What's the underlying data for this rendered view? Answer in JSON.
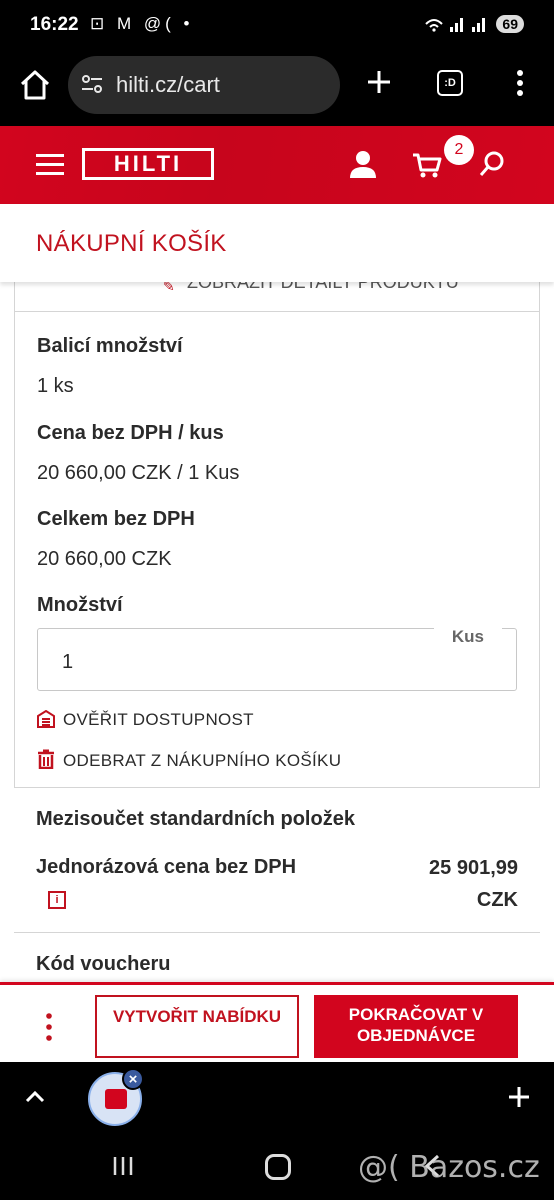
{
  "status_bar": {
    "time": "16:22",
    "left_icons": "⊡ M @(  •",
    "right_icons": "wifi ▂▄▆ ▂▄▆",
    "battery": "69"
  },
  "browser": {
    "url": "hilti.cz/cart",
    "tabs_label": ":D"
  },
  "header": {
    "logo_text": "HILTI",
    "cart_count": "2",
    "brand_color": "#d2051e"
  },
  "page": {
    "title": "NÁKUPNÍ KOŠÍK"
  },
  "product": {
    "details_link": "ZOBRAZIT DETAILY PRODUKTU",
    "pack_label": "Balicí množství",
    "pack_value": "1 ks",
    "unit_price_label": "Cena bez DPH / kus",
    "unit_price_value": "20 660,00 CZK / 1 Kus",
    "total_label": "Celkem bez DPH",
    "total_value": "20 660,00 CZK",
    "quantity_label": "Množství",
    "quantity_value": "1",
    "quantity_unit": "Kus",
    "check_availability": "OVĚŘIT DOSTUPNOST",
    "remove_from_cart": "ODEBRAT Z NÁKUPNÍHO KOŠÍKU"
  },
  "summary": {
    "subtotal_title": "Mezisoučet standardních položek",
    "onetime_label": "Jednorázová cena bez DPH",
    "onetime_amount": "25 901,99",
    "onetime_currency": "CZK",
    "voucher_label": "Kód voucheru"
  },
  "actions": {
    "create_offer": "VYTVOŘIT NABÍDKU",
    "continue_order": "POKRAČOVAT V OBJEDNÁVCE"
  },
  "watermark": "@( Bazos.cz"
}
